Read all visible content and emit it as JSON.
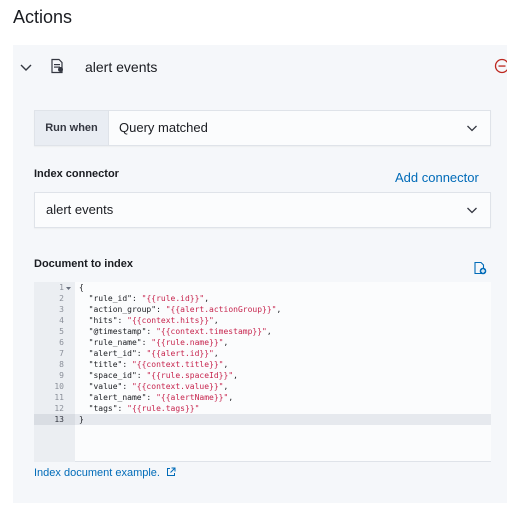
{
  "page": {
    "title": "Actions"
  },
  "action": {
    "title": "alert events",
    "run_when": {
      "label": "Run when",
      "value": "Query matched"
    },
    "connector": {
      "label": "Index connector",
      "add_link": "Add connector",
      "value": "alert events"
    },
    "document": {
      "label": "Document to index",
      "line_numbers": [
        "1",
        "2",
        "3",
        "4",
        "5",
        "6",
        "7",
        "8",
        "9",
        "10",
        "11",
        "12",
        "13"
      ],
      "lines": [
        {
          "key": "",
          "value": "",
          "text": "{"
        },
        {
          "key": "  \"rule_id\": ",
          "value": "\"{{rule.id}}\"",
          "text": ","
        },
        {
          "key": "  \"action_group\": ",
          "value": "\"{{alert.actionGroup}}\"",
          "text": ","
        },
        {
          "key": "  \"hits\": ",
          "value": "\"{{context.hits}}\"",
          "text": ","
        },
        {
          "key": "  \"@timestamp\": ",
          "value": "\"{{context.timestamp}}\"",
          "text": ","
        },
        {
          "key": "  \"rule_name\": ",
          "value": "\"{{rule.name}}\"",
          "text": ","
        },
        {
          "key": "  \"alert_id\": ",
          "value": "\"{{alert.id}}\"",
          "text": ","
        },
        {
          "key": "  \"title\": ",
          "value": "\"{{context.title}}\"",
          "text": ","
        },
        {
          "key": "  \"space_id\": ",
          "value": "\"{{rule.spaceId}}\"",
          "text": ","
        },
        {
          "key": "  \"value\": ",
          "value": "\"{{context.value}}\"",
          "text": ","
        },
        {
          "key": "  \"alert_name\": ",
          "value": "\"{{alertName}}\"",
          "text": ","
        },
        {
          "key": "  \"tags\": ",
          "value": "\"{{rule.tags}}\"",
          "text": ""
        },
        {
          "key": "",
          "value": "",
          "text": "}"
        }
      ],
      "example_link": "Index document example."
    }
  },
  "colors": {
    "link": "#006bb8",
    "danger": "#bd271e",
    "string": "#c7254e",
    "panel": "#f5f7fa"
  },
  "icons": [
    "chevron-down-icon",
    "document-icon",
    "remove-circle-icon",
    "add-variable-icon",
    "fold-arrow-icon",
    "external-link-icon"
  ]
}
